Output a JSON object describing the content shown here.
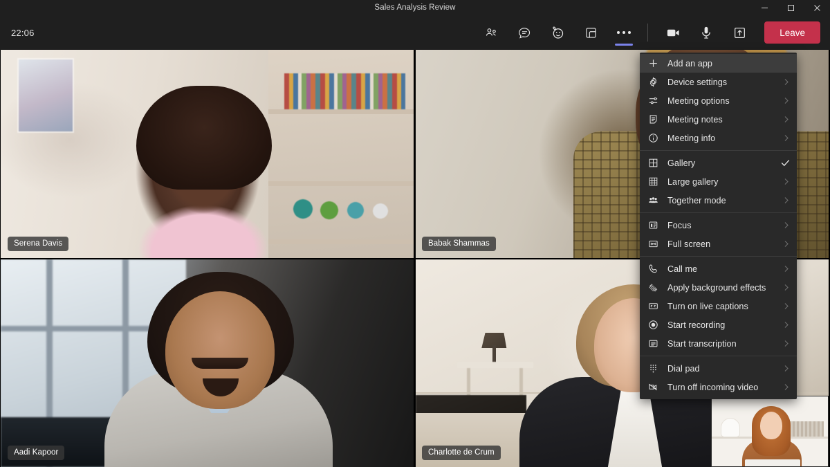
{
  "window": {
    "title": "Sales Analysis Review",
    "controls": [
      {
        "name": "minimize",
        "glyph": "minimize-icon"
      },
      {
        "name": "maximize",
        "glyph": "maximize-icon"
      },
      {
        "name": "close",
        "glyph": "close-icon"
      }
    ]
  },
  "toolbar": {
    "clock": "22:06",
    "leave_label": "Leave",
    "leave_color": "#C4314B",
    "active_accent": "#7B83EB",
    "buttons": [
      {
        "name": "show-participants",
        "icon": "people-icon",
        "label": "People"
      },
      {
        "name": "show-conversation",
        "icon": "chat-icon",
        "label": "Chat"
      },
      {
        "name": "show-reactions",
        "icon": "reactions-icon",
        "label": "Reactions"
      },
      {
        "name": "show-rooms",
        "icon": "breakout-rooms-icon",
        "label": "Rooms"
      },
      {
        "name": "more-options",
        "icon": "ellipsis-icon",
        "label": "More actions",
        "active": true
      },
      {
        "name": "toggle-camera",
        "icon": "camera-icon",
        "label": "Camera"
      },
      {
        "name": "toggle-mic",
        "icon": "microphone-icon",
        "label": "Mic"
      },
      {
        "name": "share-content",
        "icon": "share-screen-icon",
        "label": "Share"
      }
    ]
  },
  "menu": {
    "groups": [
      {
        "items": [
          {
            "icon": "plus-icon",
            "label": "Add an app",
            "highlighted": true,
            "chevron": false,
            "checked": false
          },
          {
            "icon": "gear-icon",
            "label": "Device settings",
            "highlighted": false,
            "chevron": true,
            "checked": false
          },
          {
            "icon": "sliders-icon",
            "label": "Meeting options",
            "highlighted": false,
            "chevron": true,
            "checked": false
          },
          {
            "icon": "notes-icon",
            "label": "Meeting notes",
            "highlighted": false,
            "chevron": true,
            "checked": false
          },
          {
            "icon": "info-icon",
            "label": "Meeting info",
            "highlighted": false,
            "chevron": true,
            "checked": false
          }
        ]
      },
      {
        "items": [
          {
            "icon": "grid-2x2-icon",
            "label": "Gallery",
            "highlighted": false,
            "chevron": false,
            "checked": true
          },
          {
            "icon": "grid-3x3-icon",
            "label": "Large gallery",
            "highlighted": false,
            "chevron": true,
            "checked": false
          },
          {
            "icon": "together-mode-icon",
            "label": "Together mode",
            "highlighted": false,
            "chevron": true,
            "checked": false
          }
        ]
      },
      {
        "items": [
          {
            "icon": "focus-icon",
            "label": "Focus",
            "highlighted": false,
            "chevron": true,
            "checked": false
          },
          {
            "icon": "full-screen-icon",
            "label": "Full screen",
            "highlighted": false,
            "chevron": true,
            "checked": false
          }
        ]
      },
      {
        "items": [
          {
            "icon": "phone-icon",
            "label": "Call me",
            "highlighted": false,
            "chevron": true,
            "checked": false
          },
          {
            "icon": "background-effects-icon",
            "label": "Apply background effects",
            "highlighted": false,
            "chevron": true,
            "checked": false
          },
          {
            "icon": "closed-captions-icon",
            "label": "Turn on live captions",
            "highlighted": false,
            "chevron": true,
            "checked": false
          },
          {
            "icon": "record-icon",
            "label": "Start recording",
            "highlighted": false,
            "chevron": true,
            "checked": false
          },
          {
            "icon": "transcription-icon",
            "label": "Start transcription",
            "highlighted": false,
            "chevron": true,
            "checked": false
          }
        ]
      },
      {
        "items": [
          {
            "icon": "dial-pad-icon",
            "label": "Dial pad",
            "highlighted": false,
            "chevron": true,
            "checked": false
          },
          {
            "icon": "video-off-icon",
            "label": "Turn off incoming video",
            "highlighted": false,
            "chevron": true,
            "checked": false
          }
        ]
      }
    ]
  },
  "stage": {
    "layout": "gallery-2x2",
    "participants": [
      {
        "name": "Serena Davis"
      },
      {
        "name": "Babak Shammas"
      },
      {
        "name": "Aadi Kapoor"
      },
      {
        "name": "Charlotte de Crum"
      }
    ],
    "self_view": {
      "name": "self-view-thumbnail"
    }
  }
}
